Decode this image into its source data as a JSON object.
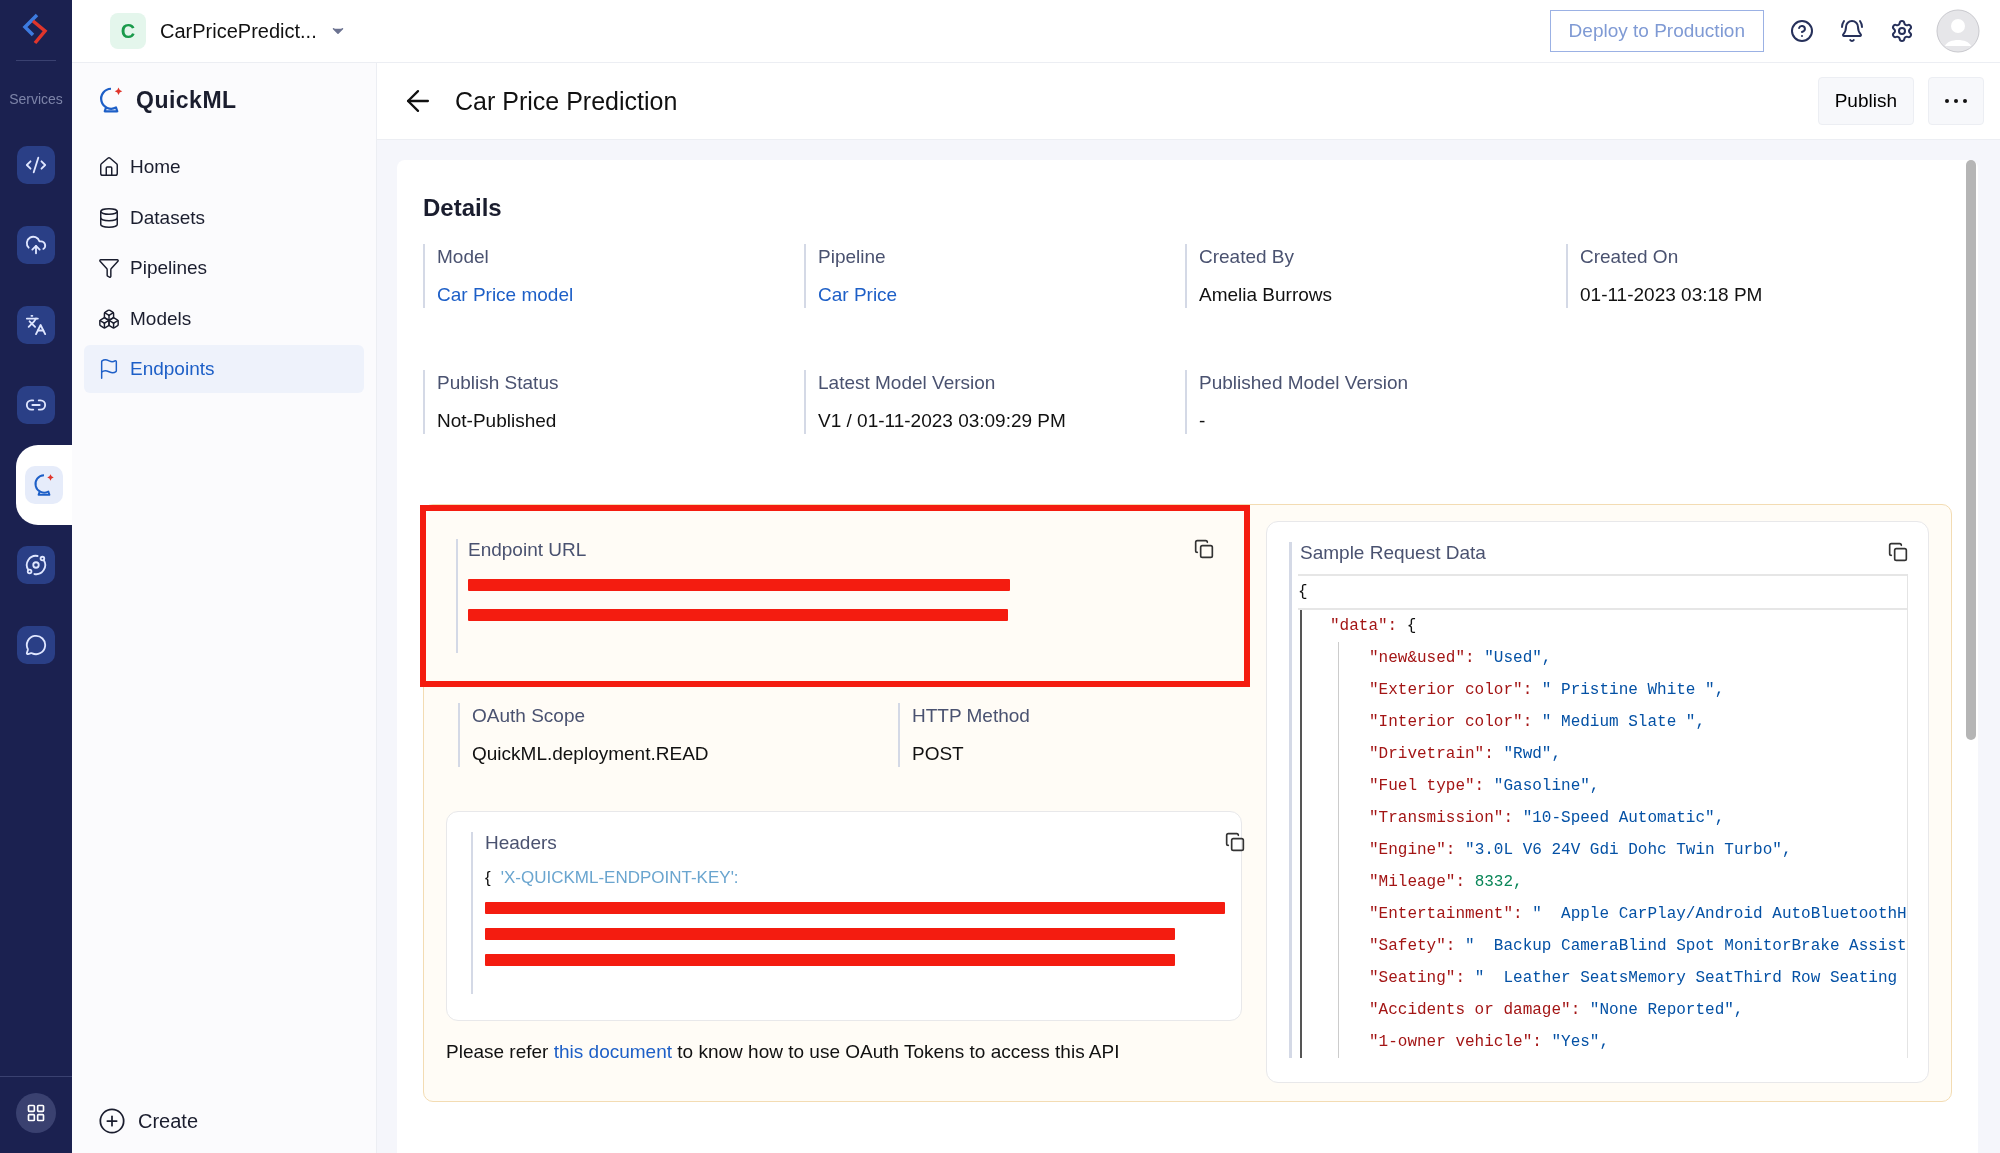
{
  "rail": {
    "label": "Services",
    "items": [
      {
        "selected": false
      },
      {
        "selected": false
      },
      {
        "selected": false
      },
      {
        "selected": false
      },
      {
        "selected": true
      },
      {
        "selected": false
      },
      {
        "selected": false
      }
    ]
  },
  "topbar": {
    "project_initial": "C",
    "project_name": "CarPricePredict...",
    "deploy_button": "Deploy to Production"
  },
  "sidebar": {
    "title": "QuickML",
    "items": [
      {
        "label": "Home",
        "selected": false
      },
      {
        "label": "Datasets",
        "selected": false
      },
      {
        "label": "Pipelines",
        "selected": false
      },
      {
        "label": "Models",
        "selected": false
      },
      {
        "label": "Endpoints",
        "selected": true
      }
    ],
    "create": "Create"
  },
  "page": {
    "title": "Car Price Prediction",
    "publish_button": "Publish"
  },
  "details": {
    "title": "Details",
    "rows": [
      [
        {
          "label": "Model",
          "value": "Car Price model",
          "link": true
        },
        {
          "label": "Pipeline",
          "value": "Car Price",
          "link": true
        },
        {
          "label": "Created By",
          "value": "Amelia Burrows",
          "link": false
        },
        {
          "label": "Created On",
          "value": "01-11-2023 03:18 PM",
          "link": false
        }
      ],
      [
        {
          "label": "Publish Status",
          "value": "Not-Published",
          "link": false
        },
        {
          "label": "Latest Model Version",
          "value": "V1 / 01-11-2023 03:09:29 PM",
          "link": false
        },
        {
          "label": "Published Model Version",
          "value": "-",
          "link": false
        }
      ]
    ]
  },
  "endpoint": {
    "url_label": "Endpoint URL",
    "highlighted": true,
    "fields": [
      {
        "label": "OAuth Scope",
        "value": "QuickML.deployment.READ"
      },
      {
        "label": "HTTP Method",
        "value": "POST"
      }
    ],
    "headers": {
      "title": "Headers",
      "open": "{",
      "key": "'X-QUICKML-ENDPOINT-KEY':"
    },
    "note_before": "Please refer",
    "note_link": "this document",
    "note_after": "to know how to use OAuth Tokens to access this API"
  },
  "sample": {
    "title": "Sample Request Data",
    "code": {
      "open": "{",
      "children": [
        {
          "key": "\"data\":",
          "value": "{",
          "children": [
            {
              "key": "\"new&used\":",
              "value": "\"Used\",",
              "kind": "string"
            },
            {
              "key": "\"Exterior color\":",
              "value": "\" Pristine White \",",
              "kind": "string"
            },
            {
              "key": "\"Interior color\":",
              "value": "\" Medium Slate \",",
              "kind": "string"
            },
            {
              "key": "\"Drivetrain\":",
              "value": "\"Rwd\",",
              "kind": "string"
            },
            {
              "key": "\"Fuel type\":",
              "value": "\"Gasoline\",",
              "kind": "string"
            },
            {
              "key": "\"Transmission\":",
              "value": "\"10-Speed Automatic\",",
              "kind": "string"
            },
            {
              "key": "\"Engine\":",
              "value": "\"3.0L V6 24V Gdi Dohc Twin Turbo\",",
              "kind": "string"
            },
            {
              "key": "\"Mileage\":",
              "value": "8332,",
              "kind": "number"
            },
            {
              "key": "\"Entertainment\":",
              "value": "\"  Apple CarPlay/Android AutoBluetoothH",
              "kind": "string"
            },
            {
              "key": "\"Safety\":",
              "value": "\"  Backup CameraBlind Spot MonitorBrake Assist",
              "kind": "string"
            },
            {
              "key": "\"Seating\":",
              "value": "\"  Leather SeatsMemory SeatThird Row Seating",
              "kind": "string"
            },
            {
              "key": "\"Accidents or damage\":",
              "value": "\"None Reported\",",
              "kind": "string"
            },
            {
              "key": "\"1-owner vehicle\":",
              "value": "\"Yes\",",
              "kind": "string"
            }
          ]
        }
      ]
    }
  }
}
